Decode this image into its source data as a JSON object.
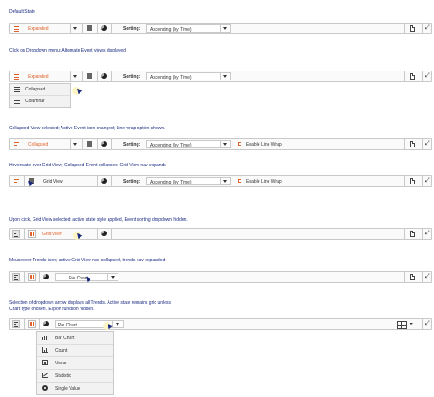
{
  "captions": [
    "Default State",
    "Click on Dropdown menu; Alternate Event views displayed",
    "Collapsed View selected; Active Event icon changed; Line wrap option shown.",
    "Hoverstate over Grid View; Collapsed Event collapses, Grid View nav expands",
    "Upon click, Grid View selected; active state style applied, Event sorting dropdown hidden.",
    "Mouseover Trends icon; active Grid View nav collapsed, trends nav expanded.",
    "Selection of dropdown arrow displays all Trends. Active state remains grid unless",
    "Chart type chosen. Export function hidden."
  ],
  "view_labels": {
    "expanded": "Expanded",
    "collapsed": "Collapsed",
    "grid": "Grid View",
    "pie": "Pie Chart"
  },
  "sorting": {
    "label": "Sorting:",
    "value": "Ascending (by Time)"
  },
  "line_wrap": "Enable Line Wrap",
  "event_menu": [
    "Collapsed",
    "Columnar"
  ],
  "trends_menu": [
    {
      "label": "Bar Chart",
      "icon": "bar-chart-icon"
    },
    {
      "label": "Count",
      "icon": "count-icon"
    },
    {
      "label": "Value",
      "icon": "value-icon"
    },
    {
      "label": "Statistic",
      "icon": "statistic-icon"
    },
    {
      "label": "Single Value",
      "icon": "single-value-icon"
    }
  ],
  "colors": {
    "accent": "#e0642a",
    "caption": "#1a2a80",
    "border": "#c9c9c9"
  }
}
